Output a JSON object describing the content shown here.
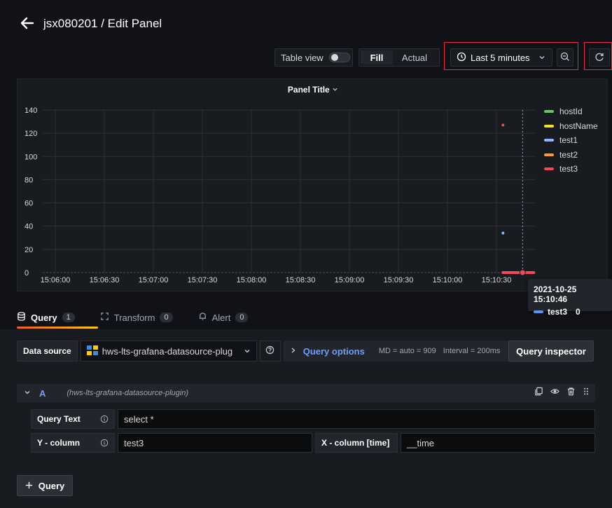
{
  "header": {
    "title": "jsx080201 / Edit Panel"
  },
  "toolbar": {
    "table_view_label": "Table view",
    "fill_label": "Fill",
    "actual_label": "Actual",
    "time_range_label": "Last 5 minutes",
    "clock_icon": "clock-icon",
    "zoom_icon": "zoom-out-icon",
    "refresh_icon": "refresh-icon"
  },
  "panel": {
    "title": "Panel Title",
    "legend": [
      {
        "name": "hostId",
        "color": "#73bf69"
      },
      {
        "name": "hostName",
        "color": "#fade2a"
      },
      {
        "name": "test1",
        "color": "#8ab8ff"
      },
      {
        "name": "test2",
        "color": "#ff9830"
      },
      {
        "name": "test3",
        "color": "#f2495c"
      }
    ]
  },
  "chart_data": {
    "type": "line",
    "x_ticks": [
      "15:06:00",
      "15:06:30",
      "15:07:00",
      "15:07:30",
      "15:08:00",
      "15:08:30",
      "15:09:00",
      "15:09:30",
      "15:10:00",
      "15:10:30"
    ],
    "y_ticks": [
      0,
      20,
      40,
      60,
      80,
      100,
      120,
      140
    ],
    "ylim": [
      0,
      140
    ],
    "series": [
      {
        "name": "test1",
        "color": "#8ab8ff",
        "points": [
          {
            "x": "15:10:34",
            "y": 34
          }
        ]
      },
      {
        "name": "test3",
        "color": "#f2495c",
        "points": [
          {
            "x": "15:10:34",
            "y": 127
          },
          {
            "x": "15:10:34",
            "y": 0
          },
          {
            "x": "15:10:46",
            "y": 0
          }
        ]
      }
    ],
    "hover_x": "15:10:46"
  },
  "tooltip": {
    "time": "2021-10-25 15:10:46",
    "series": "test3",
    "value": "0"
  },
  "tabs": [
    {
      "label": "Query",
      "count": "1"
    },
    {
      "label": "Transform",
      "count": "0"
    },
    {
      "label": "Alert",
      "count": "0"
    }
  ],
  "query": {
    "data_source_label": "Data source",
    "data_source_value": "hws-lts-grafana-datasource-plug",
    "query_options_label": "Query options",
    "md_text": "MD = auto = 909",
    "interval_text": "Interval = 200ms",
    "inspector_label": "Query inspector",
    "row_letter": "A",
    "row_ds": "(hws-lts-grafana-datasource-plugin)",
    "query_text_label": "Query Text",
    "query_text_value": "select *",
    "y_column_label": "Y - column",
    "y_column_value": "test3",
    "x_column_label": "X - column [time]",
    "x_column_value": "__time",
    "add_query_label": "Query"
  }
}
